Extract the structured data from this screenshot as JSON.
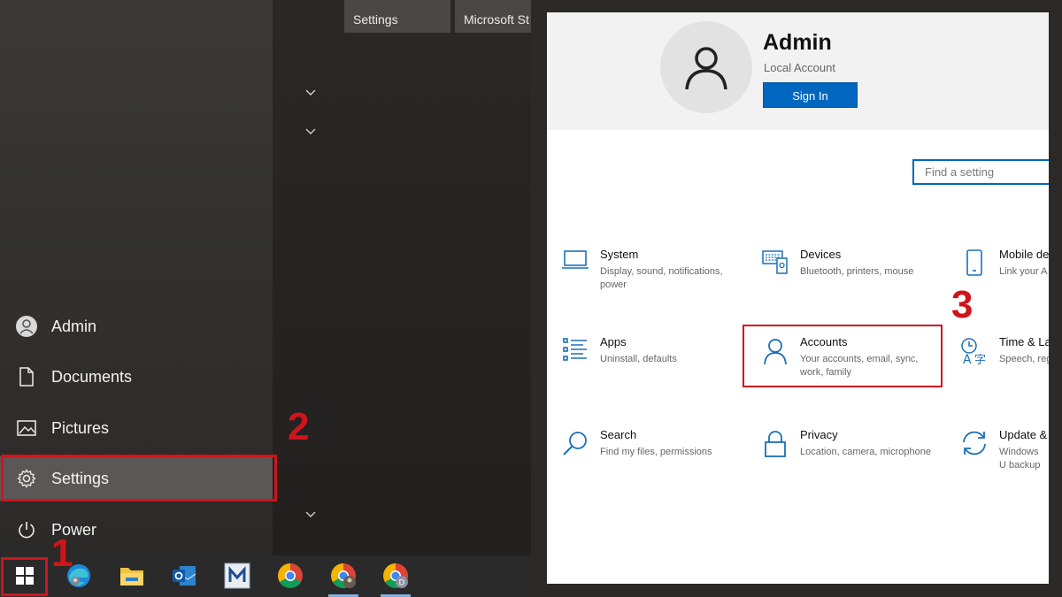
{
  "start_menu": {
    "items": [
      {
        "label": "Admin",
        "icon": "user-avatar-icon"
      },
      {
        "label": "Documents",
        "icon": "document-icon"
      },
      {
        "label": "Pictures",
        "icon": "pictures-icon"
      },
      {
        "label": "Settings",
        "icon": "gear-icon"
      },
      {
        "label": "Power",
        "icon": "power-icon"
      }
    ]
  },
  "tiles": {
    "tab_settings": "Settings",
    "tab_store": "Microsoft St"
  },
  "taskbar": {
    "icons": [
      "windows-start-icon",
      "edge-icon",
      "file-explorer-icon",
      "outlook-icon",
      "m-app-icon",
      "chrome-icon",
      "chrome-profile-icon",
      "chrome-profile-d-icon"
    ]
  },
  "settings": {
    "user_name": "Admin",
    "account_type": "Local Account",
    "sign_in_label": "Sign In",
    "search_placeholder": "Find a setting",
    "categories": [
      {
        "title": "System",
        "desc": "Display, sound, notifications, power"
      },
      {
        "title": "Devices",
        "desc": "Bluetooth, printers, mouse"
      },
      {
        "title": "Mobile de",
        "desc": "Link your A"
      },
      {
        "title": "Apps",
        "desc": "Uninstall, defaults"
      },
      {
        "title": "Accounts",
        "desc": "Your accounts, email, sync, work, family"
      },
      {
        "title": "Time & La",
        "desc": "Speech, regi"
      },
      {
        "title": "Search",
        "desc": "Find my files, permissions"
      },
      {
        "title": "Privacy",
        "desc": "Location, camera, microphone"
      },
      {
        "title": "Update &",
        "desc": "Windows U backup"
      }
    ]
  },
  "annotations": {
    "step1": "1",
    "step2": "2",
    "step3": "3",
    "highlight_color": "#d0141b"
  },
  "colors": {
    "accent": "#0067c0",
    "icon_blue": "#1b6fb8"
  }
}
